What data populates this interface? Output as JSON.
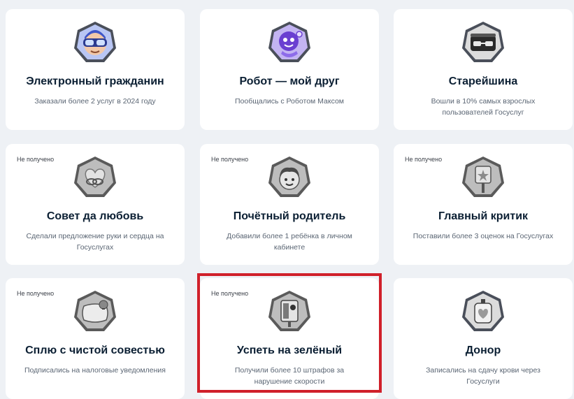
{
  "achievements": [
    {
      "status": "",
      "title": "Электронный гражданин",
      "description": "Заказали более 2 услуг в 2024 году",
      "icon": "vr-headset-citizen-icon",
      "received": true
    },
    {
      "status": "",
      "title": "Робот — мой друг",
      "description": "Пообщались с Роботом Максом",
      "icon": "robot-max-icon",
      "received": true
    },
    {
      "status": "",
      "title": "Старейшина",
      "description": "Вошли в 10% самых взрослых пользователей Госуслуг",
      "icon": "elder-glasses-icon",
      "received": true
    },
    {
      "status": "Не получено",
      "title": "Совет да любовь",
      "description": "Сделали предложение руки и сердца на Госуслугах",
      "icon": "wedding-rings-heart-icon",
      "received": false
    },
    {
      "status": "Не получено",
      "title": "Почётный родитель",
      "description": "Добавили более 1 ребёнка в личном кабинете",
      "icon": "child-face-icon",
      "received": false
    },
    {
      "status": "Не получено",
      "title": "Главный критик",
      "description": "Поставили более 3 оценок на Госуслугах",
      "icon": "star-sign-icon",
      "received": false
    },
    {
      "status": "Не получено",
      "title": "Сплю с чистой совестью",
      "description": "Подписались на налоговые уведомления",
      "icon": "pillow-bell-icon",
      "received": false
    },
    {
      "status": "Не получено",
      "title": "Успеть на зелёный",
      "description": "Получили более 10 штрафов за нарушение скорости",
      "icon": "speed-camera-icon",
      "received": false
    },
    {
      "status": "",
      "title": "Донор",
      "description": "Записались на сдачу крови через Госуслуги",
      "icon": "blood-bag-icon",
      "received": true
    }
  ],
  "colors": {
    "badge_active_bg": "#a9b8f0",
    "badge_active_border": "#5a6fd8",
    "badge_inactive_bg": "#c9c9c9",
    "badge_inactive_border": "#6e6e6e",
    "highlight": "#d0202a"
  }
}
